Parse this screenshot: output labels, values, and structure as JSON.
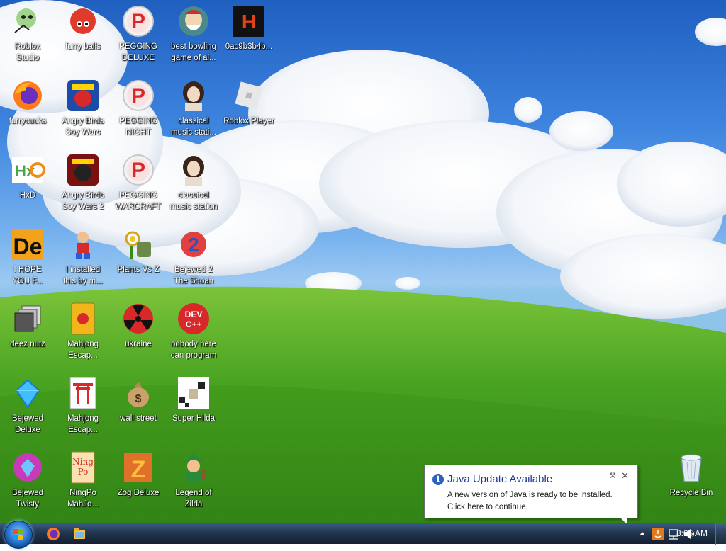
{
  "desktop": {
    "icons": [
      {
        "label": "Roblox\nStudio",
        "icon": "roblox-studio-icon"
      },
      {
        "label": "furry balls",
        "icon": "red-fuzzball-icon"
      },
      {
        "label": "PEGGING\nDELUXE",
        "icon": "pegging-p-icon"
      },
      {
        "label": "best bowling\ngame of al...",
        "icon": "bowling-santa-icon"
      },
      {
        "label": "0ac9b3b4b...",
        "icon": "black-h-icon"
      },
      {
        "label": "furrycucks",
        "icon": "firefox-icon"
      },
      {
        "label": "Angry Birds\nSoy Wars",
        "icon": "angry-birds-star-wars-icon"
      },
      {
        "label": "PEGGING\nNIGHT",
        "icon": "pegging-p-icon"
      },
      {
        "label": "classical\nmusic stati...",
        "icon": "classical-portrait-icon"
      },
      {
        "label": "Roblox Player",
        "icon": "roblox-player-icon"
      },
      {
        "label": "HxD",
        "icon": "hxd-icon"
      },
      {
        "label": "Angry Birds\nSoy Wars 2",
        "icon": "angry-birds-star-wars-2-icon"
      },
      {
        "label": "PEGGING\nWARCRAFT",
        "icon": "pegging-p-icon"
      },
      {
        "label": "classical\nmusic station",
        "icon": "classical-portrait-icon"
      },
      {
        "label": "I HOPE\nYOU F...",
        "icon": "de-icon"
      },
      {
        "label": "I installed\nthis by m...",
        "icon": "running-character-icon"
      },
      {
        "label": "Plants Vs Z",
        "icon": "plants-vs-zombies-icon"
      },
      {
        "label": "Bejewed 2\nThe Shoah",
        "icon": "bejeweled-2-icon"
      },
      {
        "label": "deez nutz",
        "icon": "stacked-windows-icon"
      },
      {
        "label": "Mahjong\nEscap...",
        "icon": "mahjong-tile-icon"
      },
      {
        "label": "ukraine",
        "icon": "radiation-icon"
      },
      {
        "label": "nobody here\ncan program",
        "icon": "dev-cpp-icon"
      },
      {
        "label": "Bejewed\nDeluxe",
        "icon": "blue-gem-icon"
      },
      {
        "label": "Mahjong\nEscap...",
        "icon": "torii-gate-icon"
      },
      {
        "label": "wall street",
        "icon": "money-bag-icon"
      },
      {
        "label": "Super Hilda",
        "icon": "pixel-art-icon"
      },
      {
        "label": "Bejewed\nTwisty",
        "icon": "twist-gem-icon"
      },
      {
        "label": "NingPo\nMahJo...",
        "icon": "ningpo-tile-icon"
      },
      {
        "label": "Zog Deluxe",
        "icon": "zog-z-icon"
      },
      {
        "label": "Legend of\nZilda",
        "icon": "zelda-character-icon"
      },
      {
        "label": "Recycle Bin",
        "icon": "recycle-bin-icon"
      }
    ]
  },
  "balloon": {
    "title": "Java Update Available",
    "body": "A new version of Java is ready to be installed.\nClick here to continue.",
    "info_glyph": "i",
    "close_glyph": "✕"
  },
  "taskbar": {
    "clock": "8:05 AM",
    "pinned": [
      "firefox-icon",
      "folder-icon"
    ],
    "tray_icons": [
      "show-hidden-icon",
      "java-tray-icon",
      "network-icon",
      "volume-icon"
    ]
  },
  "colors": {
    "sky_top": "#1f5fc0",
    "grass": "#3f9a1c",
    "taskbar": "#22364f",
    "balloon_title": "#1c3a9c"
  }
}
